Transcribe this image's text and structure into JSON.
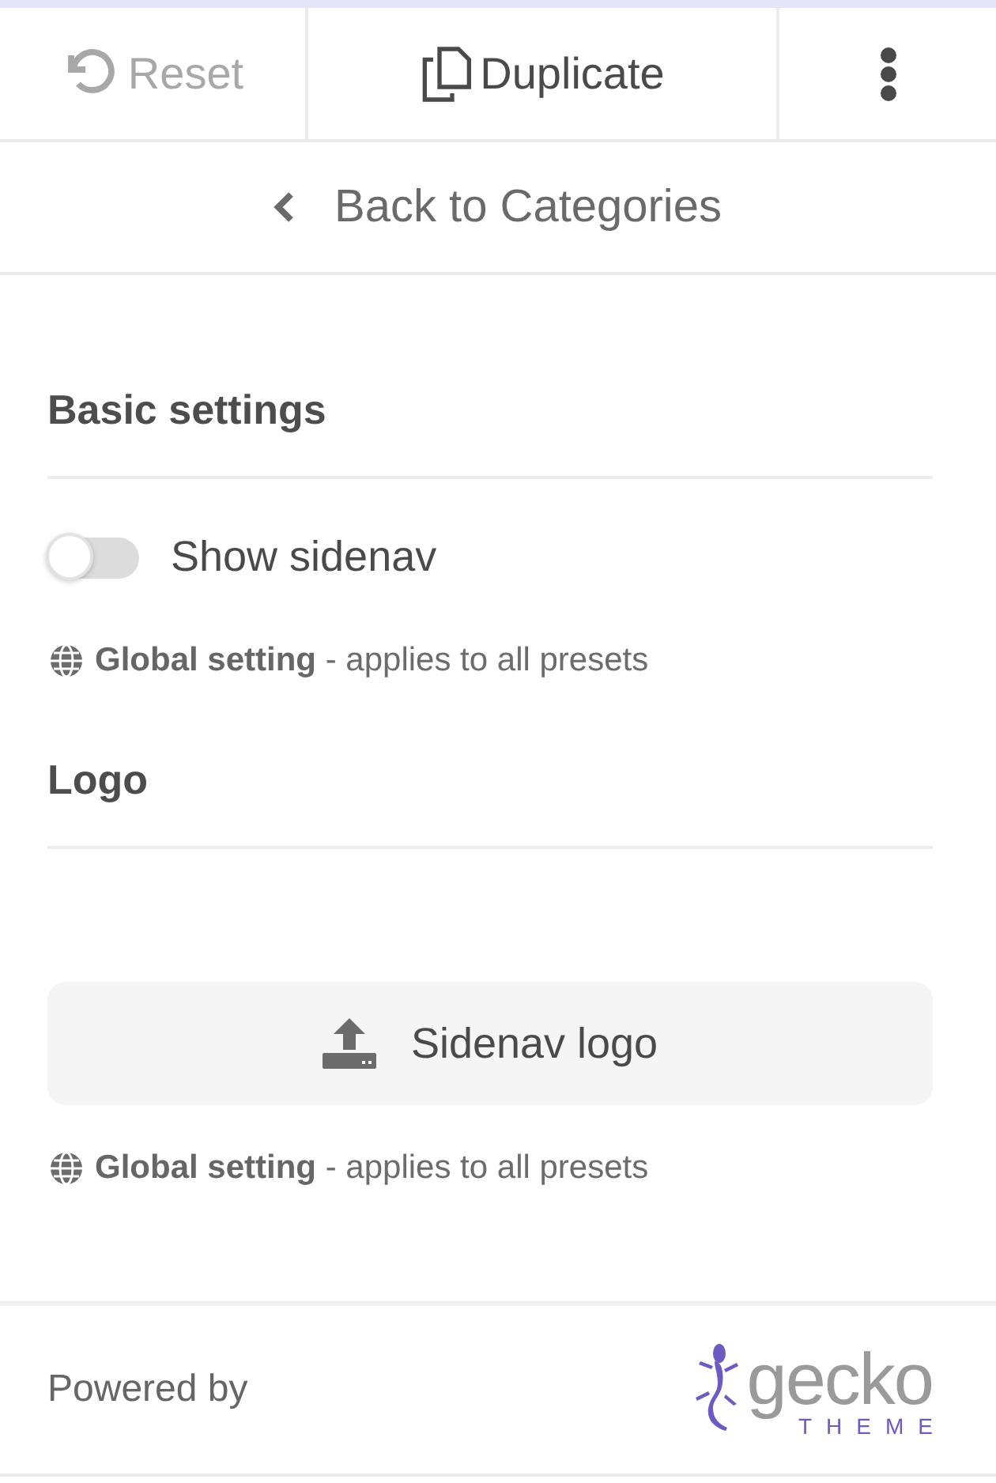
{
  "toolbar": {
    "reset": {
      "label": "Reset",
      "disabled": true
    },
    "duplicate": {
      "label": "Duplicate",
      "disabled": false
    }
  },
  "back_link": {
    "label": "Back to Categories"
  },
  "sections": [
    {
      "title": "Basic settings",
      "controls": [
        {
          "kind": "toggle",
          "label": "Show sidenav",
          "on": false
        }
      ],
      "note": "**Global setting** - applies to all presets"
    },
    {
      "title": "Logo",
      "controls": [
        {
          "kind": "upload",
          "label": "Sidenav logo"
        }
      ],
      "note": "**Global setting** - applies to all presets"
    }
  ],
  "footer": {
    "text": "Powered by",
    "logo": {
      "word": "gecko",
      "sub": "THEME"
    }
  }
}
